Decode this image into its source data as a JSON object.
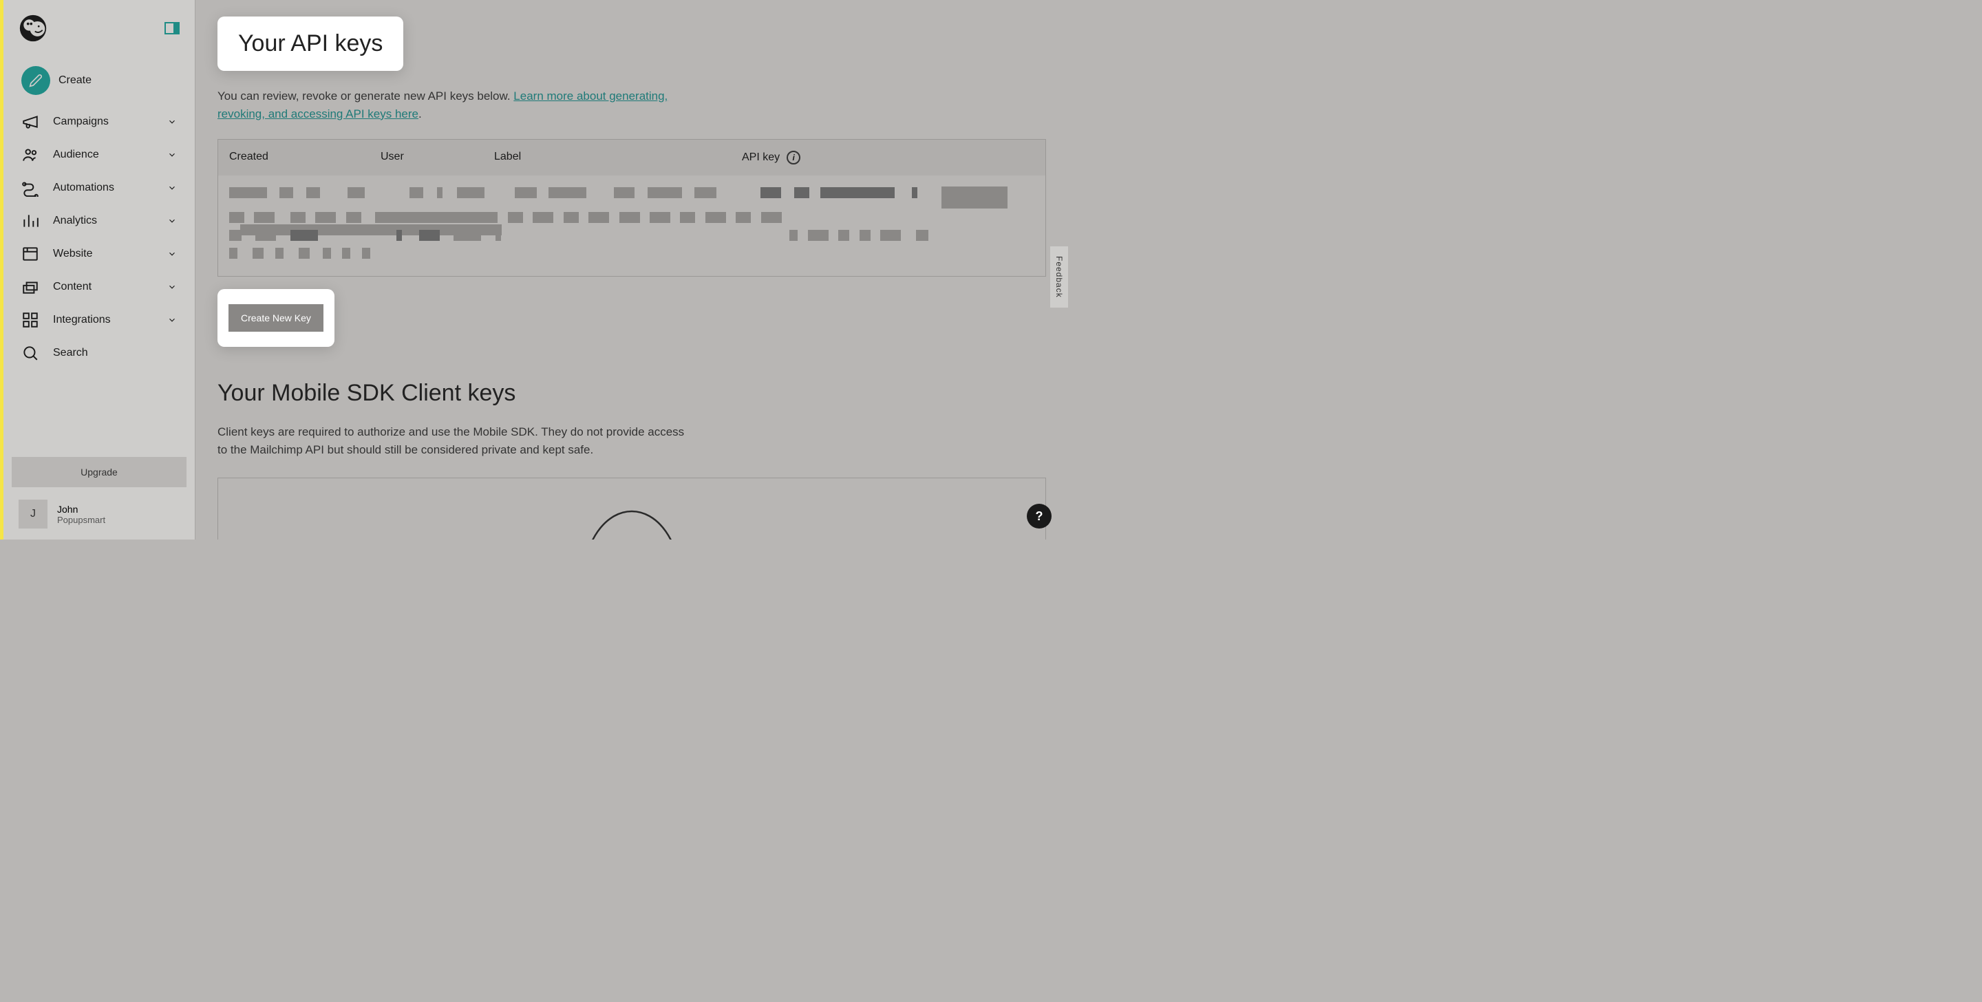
{
  "sidebar": {
    "create_label": "Create",
    "items": [
      {
        "label": "Campaigns",
        "icon": "megaphone"
      },
      {
        "label": "Audience",
        "icon": "users"
      },
      {
        "label": "Automations",
        "icon": "workflow"
      },
      {
        "label": "Analytics",
        "icon": "bar-chart"
      },
      {
        "label": "Website",
        "icon": "browser"
      },
      {
        "label": "Content",
        "icon": "layers"
      },
      {
        "label": "Integrations",
        "icon": "grid"
      }
    ],
    "search_label": "Search",
    "upgrade_label": "Upgrade",
    "user": {
      "initial": "J",
      "name": "John",
      "org": "Popupsmart"
    }
  },
  "page": {
    "title": "Your API keys",
    "desc_prefix": "You can review, revoke or generate new API keys below. ",
    "desc_link": "Learn more about generating, revoking, and accessing API keys here",
    "desc_suffix": "."
  },
  "table": {
    "headers": {
      "created": "Created",
      "user": "User",
      "label": "Label",
      "apikey": "API key"
    }
  },
  "create_key_label": "Create New Key",
  "sdk": {
    "title": "Your Mobile SDK Client keys",
    "desc": "Client keys are required to authorize and use the Mobile SDK. They do not provide access to the Mailchimp API but should still be considered private and kept safe."
  },
  "feedback_label": "Feedback",
  "help_label": "?"
}
